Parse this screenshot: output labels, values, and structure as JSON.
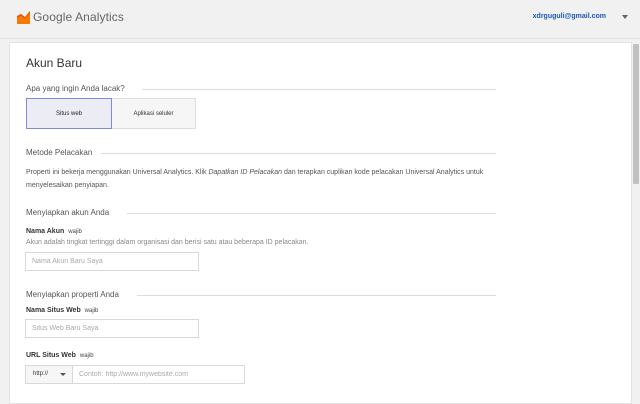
{
  "header": {
    "brand": "Google Analytics",
    "user_email": "xdrguguli@gmail.com",
    "logo_color": "#f57c00"
  },
  "page": {
    "title": "Akun Baru"
  },
  "tracking_target": {
    "heading": "Apa yang ingin Anda lacak?",
    "options": [
      "Situs web",
      "Aplikasi seluler"
    ],
    "selected": "Situs web"
  },
  "tracking_method": {
    "heading": "Metode Pelacakan",
    "text_before": "Properti ini bekerja menggunakan Universal Analytics. Klik ",
    "text_emphasis": "Dapatkan ID Pelacakan",
    "text_after": " dan terapkan cuplikan kode pelacakan Universal Analytics untuk menyelesaikan penyiapan."
  },
  "account_setup": {
    "heading": "Menyiapkan akun Anda",
    "field_label": "Nama Akun",
    "required": "wajib",
    "hint": "Akun adalah tingkat tertinggi dalam organisasi dan berisi satu atau beberapa ID pelacakan.",
    "placeholder": "Nama Akun Baru Saya",
    "value": ""
  },
  "property_setup": {
    "heading": "Menyiapkan properti Anda",
    "site_name_label": "Nama Situs Web",
    "site_name_required": "wajib",
    "site_name_placeholder": "Situs Web Baru Saya",
    "url_label": "URL Situs Web",
    "url_required": "wajib",
    "protocol": "http://",
    "url_placeholder": "Contoh: http://www.mywebsite.com"
  }
}
